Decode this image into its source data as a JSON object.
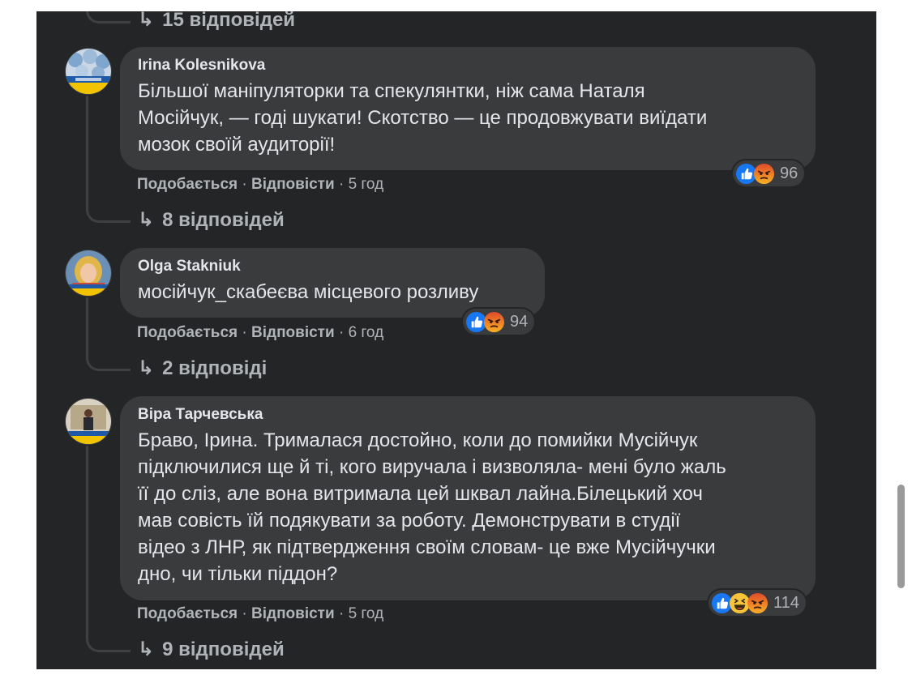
{
  "colors": {
    "panel_bg": "#242526",
    "bubble_bg": "#3a3b3c",
    "text": "#e4e6eb",
    "meta": "#b0b3b8",
    "like": "#1877f2",
    "angry": "#e9710f"
  },
  "top_replies": {
    "arrow": "↳",
    "label": "15 відповідей"
  },
  "comments": [
    {
      "author": "Irina Kolesnikova",
      "lines": [
        "Більшої маніпуляторки та спекулянтки, ніж сама Наталя",
        "Мосійчук, — годі шукати! Скотство — це продовжувати виїдати",
        "мозок своїй аудиторії!"
      ],
      "like": "Подобається",
      "sep1": "·",
      "reply": "Відповісти",
      "sep2": "·",
      "time": "5 год",
      "reactions": [
        "like-icon",
        "angry-icon"
      ],
      "reaction_count": "96",
      "replies_arrow": "↳",
      "replies_label": "8 відповідей"
    },
    {
      "author": "Olga Stakniuk",
      "lines": [
        "мосійчук_скабеєва місцевого розливу"
      ],
      "like": "Подобається",
      "sep1": "·",
      "reply": "Відповісти",
      "sep2": "·",
      "time": "6 год",
      "reactions": [
        "like-icon",
        "angry-icon"
      ],
      "reaction_count": "94",
      "replies_arrow": "↳",
      "replies_label": "2 відповіді"
    },
    {
      "author": "Віра Тарчевська",
      "lines": [
        "Браво, Ірина. Трималася достойно, коли до помийки Мусійчук",
        "підключилися ще й ті, кого виручала і визволяла- мені було жаль",
        "її до сліз, але вона витримала цей шквал лайна.Білецький хоч",
        "мав совість їй подякувати за роботу. Демонструвати в студії",
        "відео з ЛНР, як підтвердження своїм словам- це вже Мусійчучки",
        "дно, чи тільки піддон?"
      ],
      "like": "Подобається",
      "sep1": "·",
      "reply": "Відповісти",
      "sep2": "·",
      "time": "5 год",
      "reactions": [
        "like-icon",
        "haha-icon",
        "angry-icon"
      ],
      "reaction_count": "114",
      "replies_arrow": "↳",
      "replies_label": "9 відповідей"
    }
  ]
}
